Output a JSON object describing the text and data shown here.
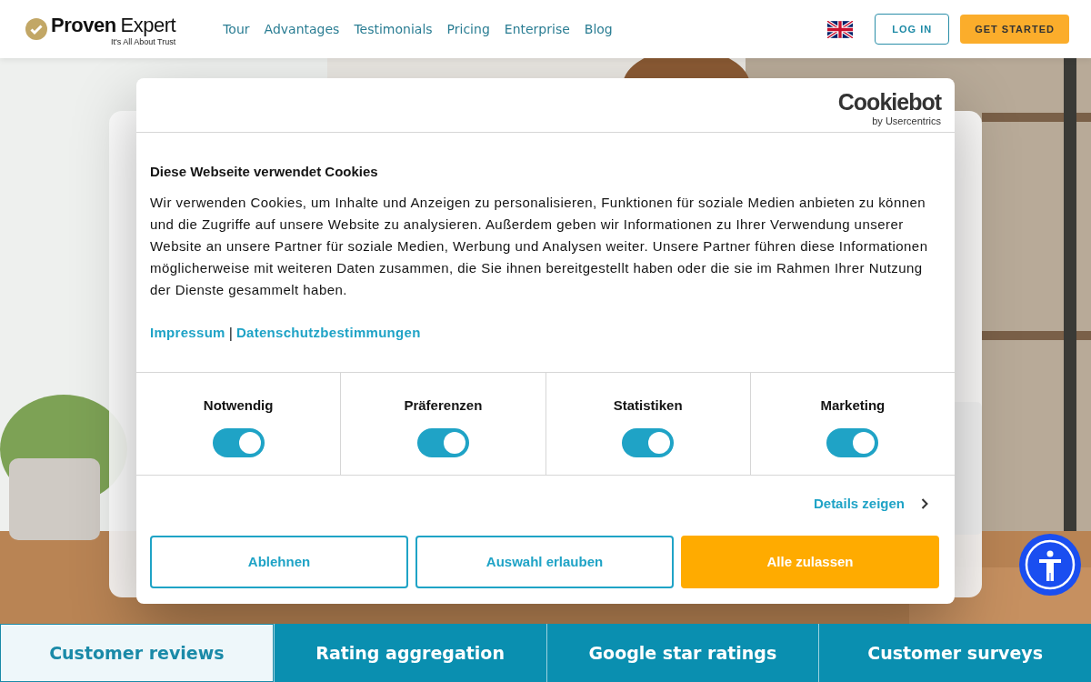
{
  "brand": {
    "name_bold": "Proven",
    "name_light": "Expert",
    "tagline": "It's All About Trust"
  },
  "nav": {
    "links": [
      "Tour",
      "Advantages",
      "Testimonials",
      "Pricing",
      "Enterprise",
      "Blog"
    ],
    "login": "LOG IN",
    "cta": "GET STARTED"
  },
  "cookie_dialog": {
    "logo": "Cookiebot",
    "logo_sub": "by Usercentrics",
    "title": "Diese Webseite verwendet Cookies",
    "text": "Wir verwenden Cookies, um Inhalte und Anzeigen zu personalisieren, Funktionen für soziale Medien anbieten zu können und die Zugriffe auf unsere Website zu analysieren. Außerdem geben wir Informationen zu Ihrer Verwendung unserer Website an unsere Partner für soziale Medien, Werbung und Analysen weiter. Unsere Partner führen diese Informationen möglicherweise mit weiteren Daten zusammen, die Sie ihnen bereitgestellt haben oder die sie im Rahmen Ihrer Nutzung der Dienste gesammelt haben.",
    "links": [
      "Impressum",
      "Datenschutzbestimmungen"
    ],
    "separator": "|",
    "categories": [
      {
        "label": "Notwendig",
        "on": true
      },
      {
        "label": "Präferenzen",
        "on": true
      },
      {
        "label": "Statistiken",
        "on": true
      },
      {
        "label": "Marketing",
        "on": true
      }
    ],
    "details": "Details zeigen",
    "buttons": [
      {
        "label": "Ablehnen",
        "kind": "outline"
      },
      {
        "label": "Auswahl erlauben",
        "kind": "outline"
      },
      {
        "label": "Alle zulassen",
        "kind": "primary"
      }
    ]
  },
  "feature_tabs": [
    {
      "label": "Customer reviews",
      "selected": true
    },
    {
      "label": "Rating aggregation",
      "selected": false
    },
    {
      "label": "Google star ratings",
      "selected": false
    },
    {
      "label": "Customer surveys",
      "selected": false
    }
  ]
}
